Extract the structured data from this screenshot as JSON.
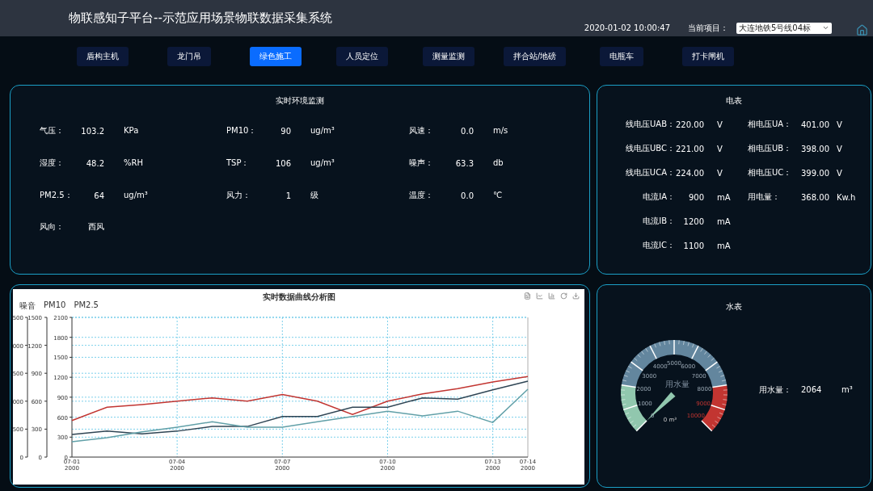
{
  "header": {
    "title": "物联感知子平台--示范应用场景物联数据采集系统",
    "datetime": "2020-01-02 10:00:47",
    "project_label": "当前项目：",
    "project_value": "大连地铁5号线04标"
  },
  "nav": [
    {
      "label": "盾构主机",
      "selected": false
    },
    {
      "label": "龙门吊",
      "selected": false
    },
    {
      "label": "绿色施工",
      "selected": true
    },
    {
      "label": "人员定位",
      "selected": false
    },
    {
      "label": "测量监测",
      "selected": false
    },
    {
      "label": "拌合站/地磅",
      "selected": false
    },
    {
      "label": "电瓶车",
      "selected": false
    },
    {
      "label": "打卡闸机",
      "selected": false
    }
  ],
  "environment": {
    "title": "实时环境监测",
    "columns": [
      [
        {
          "label": "气压：",
          "value": "103.2",
          "unit": "KPa"
        },
        {
          "label": "湿度：",
          "value": "48.2",
          "unit": "%RH"
        },
        {
          "label": "PM2.5：",
          "value": "64",
          "unit": "ug/m³"
        },
        {
          "label": "风向：",
          "value": "西风"
        }
      ],
      [
        {
          "label": "PM10：",
          "value": "90",
          "unit": "ug/m³"
        },
        {
          "label": "TSP：",
          "value": "106",
          "unit": "ug/m³"
        },
        {
          "label": "风力：",
          "value": "1",
          "unit": "级"
        }
      ],
      [
        {
          "label": "风速：",
          "value": "0.0",
          "unit": "m/s"
        },
        {
          "label": "噪声：",
          "value": "63.3",
          "unit": "db"
        },
        {
          "label": "温度：",
          "value": "0.0",
          "unit": "℃"
        }
      ]
    ]
  },
  "electric_meter": {
    "title": "电表",
    "columns": [
      [
        {
          "label": "线电压UAB：",
          "value": "220.00",
          "unit": "V"
        },
        {
          "label": "线电压UBC：",
          "value": "221.00",
          "unit": "V"
        },
        {
          "label": "线电压UCA：",
          "value": "224.00",
          "unit": "V"
        },
        {
          "label": "电流IA：",
          "value": "900",
          "unit": "mA"
        },
        {
          "label": "电流IB：",
          "value": "1200",
          "unit": "mA"
        },
        {
          "label": "电流IC：",
          "value": "1100",
          "unit": "mA"
        }
      ],
      [
        {
          "label": "相电压UA：",
          "value": "401.00",
          "unit": "V"
        },
        {
          "label": "相电压UB：",
          "value": "398.00",
          "unit": "V"
        },
        {
          "label": "相电压UC：",
          "value": "399.00",
          "unit": "V"
        },
        {
          "label": "用电量：",
          "value": "368.00",
          "unit": "Kw.h"
        }
      ]
    ]
  },
  "chart_panel": {
    "title": "实时数据曲线分析图",
    "outer_axis_labels": [
      "500",
      "000",
      "500",
      "000",
      "500",
      "0"
    ],
    "middle_axis_labels": [
      "1500",
      "1200",
      "900",
      "600",
      "300",
      "0"
    ],
    "chart_data": {
      "type": "line",
      "grid": true,
      "categories": [
        "07-01 2000",
        null,
        null,
        "07-04 2000",
        null,
        null,
        "07-07 2000",
        null,
        null,
        "07-10 2000",
        null,
        null,
        "07-13 2000",
        "07-14 2000"
      ],
      "ylim": [
        0,
        2100
      ],
      "yticks": [
        0,
        300,
        600,
        900,
        1200,
        1500,
        1800,
        2100
      ],
      "series": [
        {
          "name": "噪音",
          "color": "#c23531",
          "values": [
            550,
            750,
            790,
            840,
            890,
            840,
            940,
            840,
            640,
            840,
            950,
            1030,
            1130,
            1210
          ]
        },
        {
          "name": "PM10",
          "color": "#2f4554",
          "values": [
            340,
            390,
            350,
            390,
            460,
            460,
            610,
            610,
            750,
            750,
            890,
            870,
            1010,
            1140
          ]
        },
        {
          "name": "PM2.5",
          "color": "#61a0a8",
          "values": [
            230,
            290,
            380,
            450,
            530,
            450,
            450,
            530,
            610,
            690,
            620,
            690,
            520,
            1020
          ]
        }
      ]
    }
  },
  "water_meter": {
    "title": "水表",
    "gauge": {
      "left_ticks": [
        "5000",
        "4000",
        "3000",
        "2000",
        "1000",
        "0"
      ],
      "right_ticks": [
        "6000",
        "7000",
        "8000",
        "9000",
        "10000"
      ],
      "title": "用水量",
      "detail": "0 m³"
    },
    "reading": {
      "label": "用水量：",
      "value": "2064",
      "unit": "m³"
    }
  }
}
